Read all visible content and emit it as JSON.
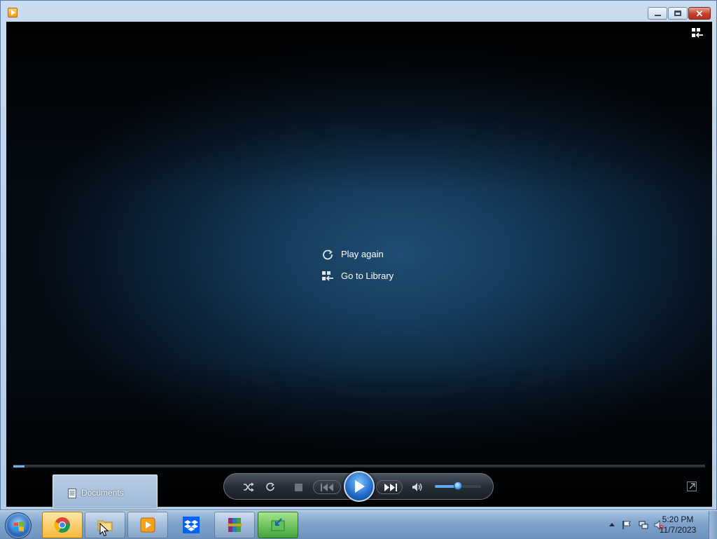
{
  "window": {
    "minimize": "",
    "maximize": "",
    "close": "✕"
  },
  "player": {
    "menu": {
      "play_again": "Play again",
      "go_to_library": "Go to Library"
    },
    "progress": 0.016,
    "volume": 0.5,
    "icons": {
      "library_toggle": "switch-to-library-icon",
      "shuffle": "shuffle-icon",
      "repeat": "repeat-icon",
      "stop": "stop-icon",
      "previous": "previous-icon",
      "play": "play-icon",
      "next": "next-icon",
      "mute": "speaker-icon",
      "fullscreen": "fullscreen-icon"
    }
  },
  "taskbar": {
    "apps": [
      {
        "name": "Google Chrome",
        "icon": "chrome-icon"
      },
      {
        "name": "Windows Explorer",
        "icon": "folder-icon"
      },
      {
        "name": "Windows Media Player",
        "icon": "media-player-icon"
      },
      {
        "name": "Dropbox",
        "icon": "dropbox-icon"
      },
      {
        "name": "WinRAR",
        "icon": "winrar-icon"
      },
      {
        "name": "Download manager",
        "icon": "download-icon"
      }
    ],
    "popup": {
      "label": "Documents"
    },
    "clock": {
      "time": "5:20 PM",
      "date": "11/7/2023"
    }
  },
  "colors": {
    "accent": "#1e68c8",
    "seek_fill": "#6fb1ff"
  }
}
